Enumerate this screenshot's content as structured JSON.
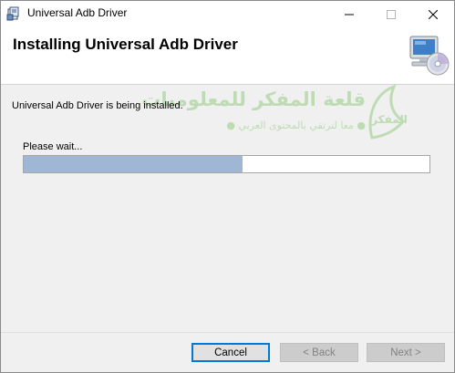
{
  "window": {
    "title": "Universal Adb Driver",
    "icon": "installer-package-icon",
    "controls": [
      "minimize-icon",
      "maximize-icon",
      "close-icon"
    ]
  },
  "header": {
    "heading": "Installing Universal Adb Driver",
    "icon": "computer-cd-icon"
  },
  "body": {
    "status": "Universal Adb Driver is being installed.",
    "wait_label": "Please wait...",
    "progress": 0.54
  },
  "watermark": {
    "line1": "قلعة المفكر للمعلوميات",
    "line2": "● معا لنرتقي بالمحتوى العربي ●",
    "logo_text": "المفكر"
  },
  "buttons": {
    "cancel": "Cancel",
    "back": "< Back",
    "next": "Next >"
  },
  "colors": {
    "progress_fill": "#9fb6d4",
    "focus_border": "#0078d7",
    "watermark": "#b6d9a9"
  }
}
